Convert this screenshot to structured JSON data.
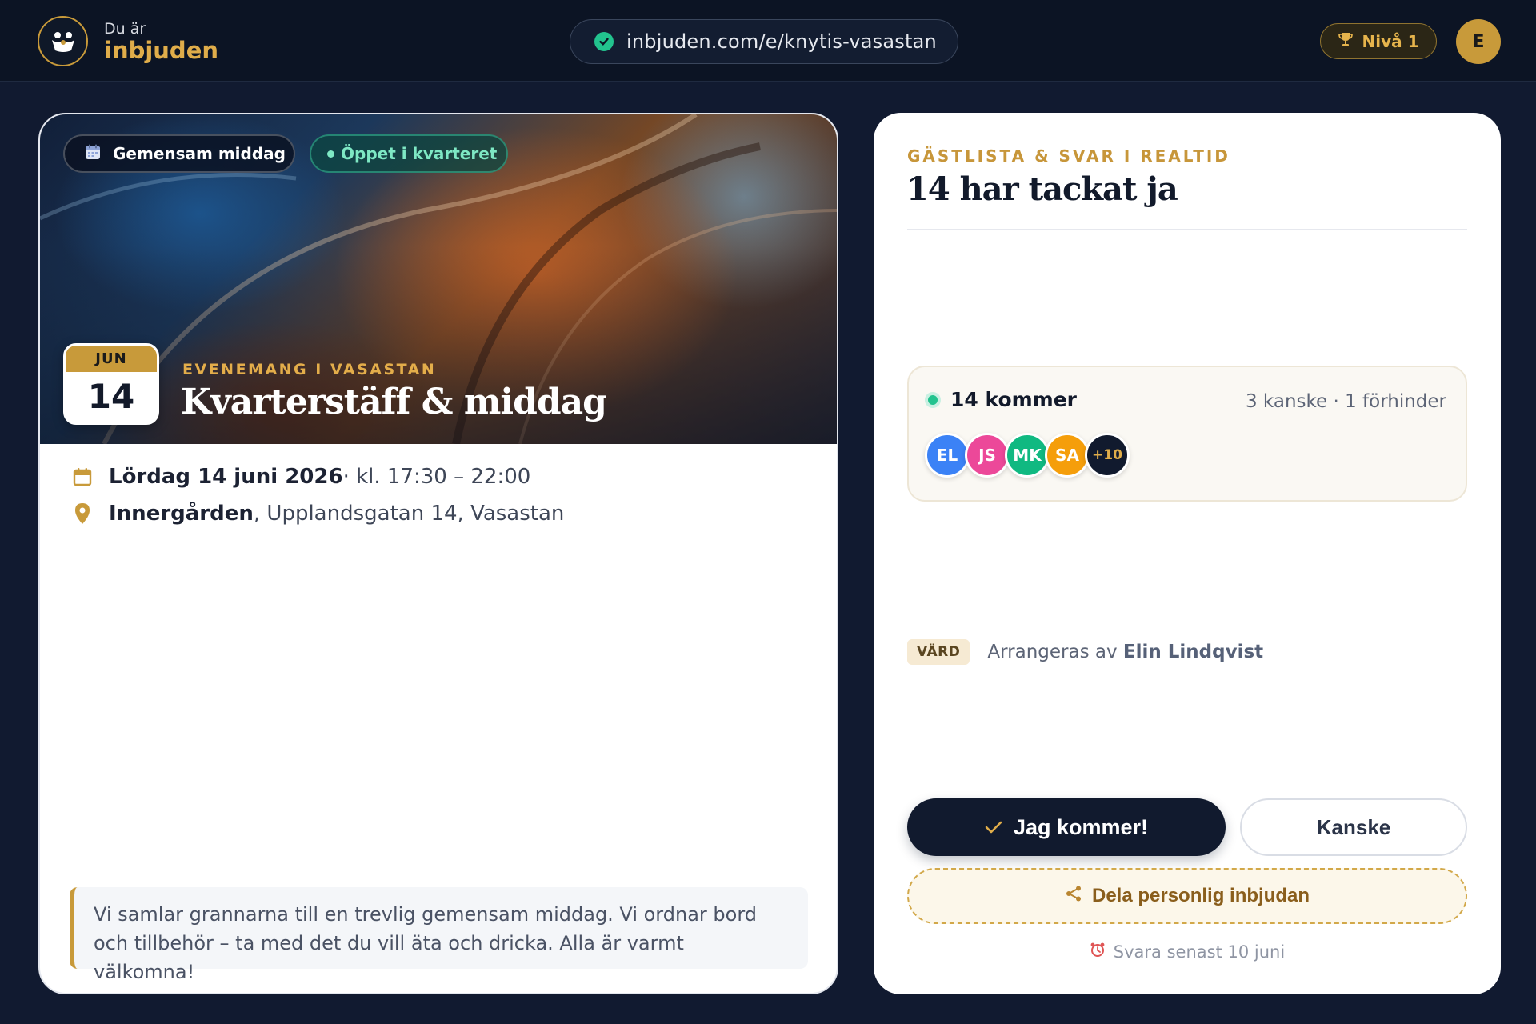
{
  "brand": {
    "subtitle": "Du är",
    "name": "inbjuden",
    "logo_icon": "people-icon"
  },
  "urlbar": {
    "url": "inbjuden.com/e/knytis-vasastan",
    "status_icon": "check-circle-icon"
  },
  "level": {
    "label": "Nivå 1",
    "icon": "trophy-icon"
  },
  "user": {
    "initial": "E"
  },
  "event": {
    "chips": {
      "category": "Gemensam middag",
      "status": "Öppet i kvarteret"
    },
    "date": {
      "month": "JUN",
      "day": "14"
    },
    "eyebrow": "EVENEMANG I VASASTAN",
    "title": "Kvarterstäff & middag",
    "when_bold": "Lördag 14 juni 2026",
    "when_rest": " · kl. 17:30 – 22:00",
    "place_bold": "Innergården",
    "place_rest": ", Upplandsgatan 14, Vasastan",
    "description": "Vi samlar grannarna till en trevlig gemensam middag. Vi ordnar bord och tillbehör – ta med det du vill äta och dricka. Alla är varmt välkomna!"
  },
  "guests": {
    "eyebrow": "GÄSTLISTA & SVAR I REALTID",
    "title": "14 har tackat ja",
    "coming": "14 kommer",
    "other": "3 kanske · 1 förhinder",
    "avatars": [
      {
        "initials": "EL",
        "color": "#3b82f6"
      },
      {
        "initials": "JS",
        "color": "#ec4899"
      },
      {
        "initials": "MK",
        "color": "#10b981"
      },
      {
        "initials": "SA",
        "color": "#f59e0b"
      },
      {
        "initials": "+10",
        "color": "#111a2e"
      }
    ]
  },
  "host": {
    "tag": "VÄRD",
    "prefix": "Arrangeras av ",
    "name": "Elin Lindqvist"
  },
  "actions": {
    "yes": "Jag kommer!",
    "maybe": "Kanske",
    "share": "Dela personlig inbjudan",
    "deadline": "Svara senast 10 juni"
  },
  "colors": {
    "accent": "#c89a3a",
    "dark": "#111a2e",
    "success": "#22c38e"
  }
}
